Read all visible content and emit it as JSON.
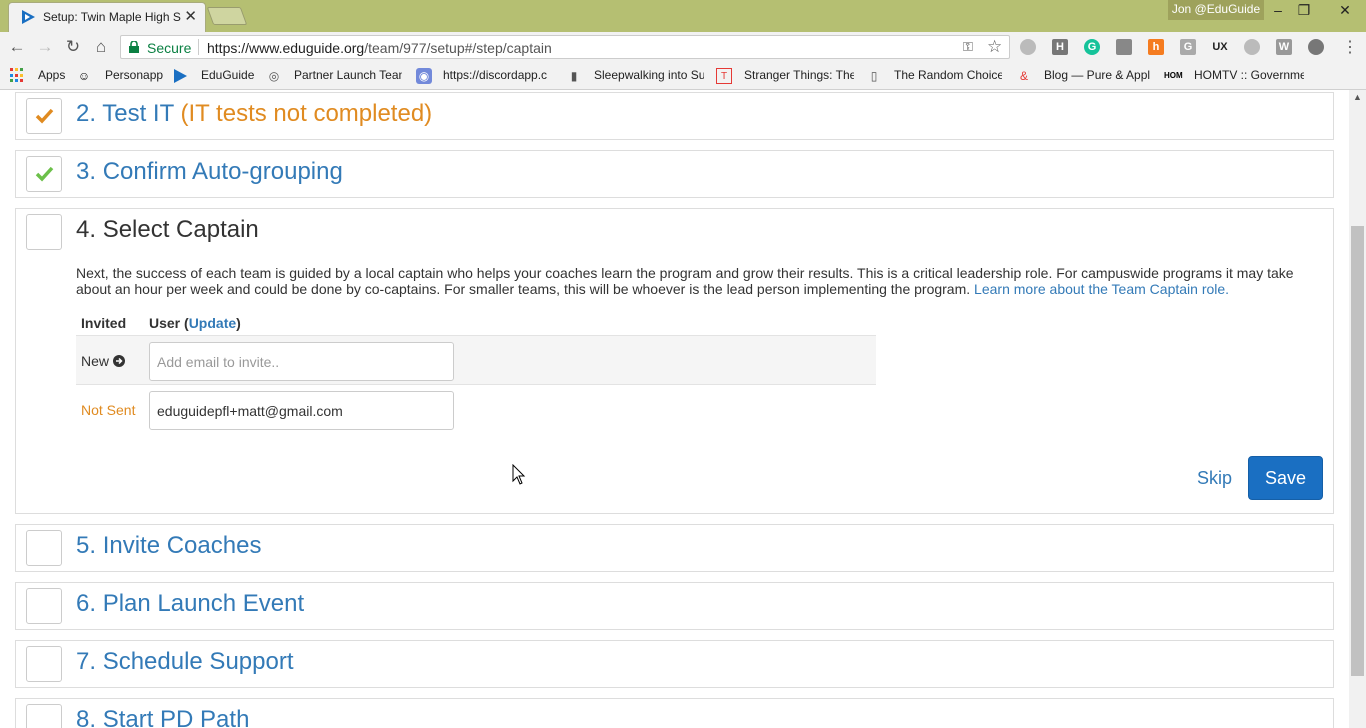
{
  "browser": {
    "tab_title": "Setup: Twin Maple High S",
    "profile_name": "Jon @EduGuide",
    "security_label": "Secure",
    "url_host": "https://www.eduguide.org",
    "url_path": "/team/977/setup#/step/captain",
    "window_controls": {
      "minimize": "–",
      "restore": "❐",
      "close": "✕"
    }
  },
  "bookmarks": [
    {
      "label": "Apps",
      "icon": "apps-grid-icon"
    },
    {
      "label": "Personapp",
      "icon": "personapp-icon"
    },
    {
      "label": "EduGuide",
      "icon": "eduguide-icon"
    },
    {
      "label": "Partner Launch Tean",
      "icon": "location-icon"
    },
    {
      "label": "https://discordapp.c",
      "icon": "discord-icon"
    },
    {
      "label": "Sleepwalking into Su",
      "icon": "bookmark-icon"
    },
    {
      "label": "Stranger Things: The",
      "icon": "tv-icon"
    },
    {
      "label": "The Random Choice",
      "icon": "page-icon"
    },
    {
      "label": "Blog — Pure & Appl",
      "icon": "ampersand-icon"
    },
    {
      "label": "HOMTV :: Governme",
      "icon": "homtv-icon"
    }
  ],
  "steps": [
    {
      "number": "2.",
      "title": "Test IT",
      "note": "(IT tests not completed)",
      "status": "warning",
      "check_color": "#e08b21"
    },
    {
      "number": "3.",
      "title": "Confirm Auto-grouping",
      "status": "done",
      "check_color": "#6cc04a"
    },
    {
      "number": "5.",
      "title": "Invite Coaches",
      "status": "pending"
    },
    {
      "number": "6.",
      "title": "Plan Launch Event",
      "status": "pending"
    },
    {
      "number": "7.",
      "title": "Schedule Support",
      "status": "pending"
    },
    {
      "number": "8.",
      "title": "Start PD Path",
      "status": "pending"
    }
  ],
  "active_step": {
    "number": "4.",
    "title": "Select Captain",
    "description": "Next, the success of each team is guided by a local captain who helps your coaches learn the program and grow their results. This is a critical leadership role. For campuswide programs it may take about an hour per week and could be done by co-captains. For smaller teams, this will be whoever is the lead person implementing the program.",
    "learn_more_link": "Learn more about the Team Captain role.",
    "table": {
      "col_invited": "Invited",
      "col_user": "User (",
      "col_user_link": "Update",
      "col_user_end": ")",
      "new_row_label": "New",
      "new_email_placeholder": "Add email to invite..",
      "sent_row_status": "Not Sent",
      "sent_row_email": "eduguidepfl+matt@gmail.com"
    },
    "skip_label": "Skip",
    "save_label": "Save"
  },
  "colors": {
    "link_blue": "#337ab7",
    "warning_orange": "#e08b21",
    "success_green": "#6cc04a",
    "primary_button": "#1a6fc2",
    "titlebar": "#b5bf72"
  }
}
